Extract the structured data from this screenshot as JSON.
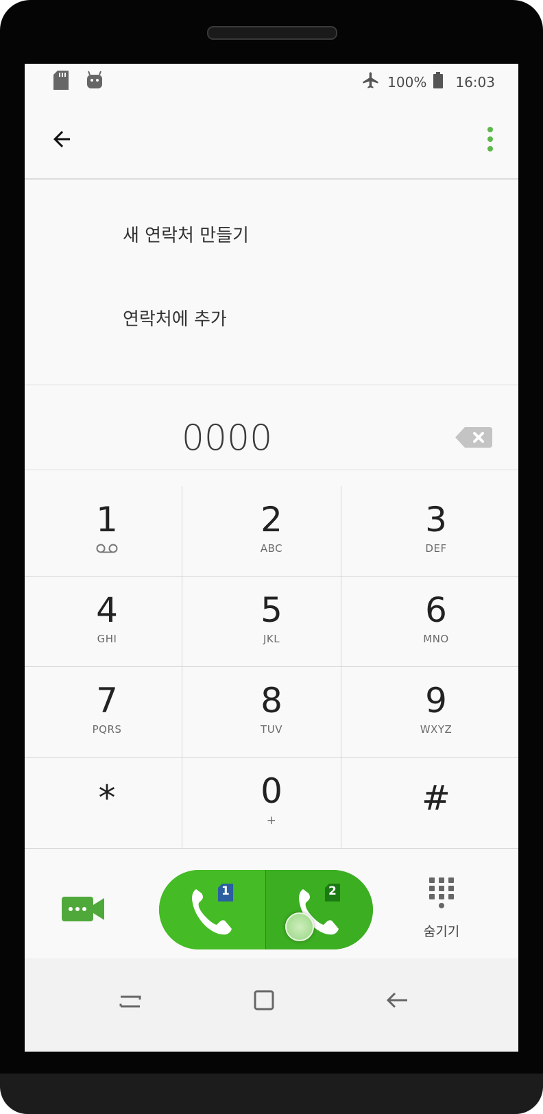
{
  "status_bar": {
    "battery": "100%",
    "time": "16:03",
    "left_icons": [
      "sd-card-icon",
      "android-icon"
    ],
    "right_icons": [
      "airplane-mode-icon",
      "battery-icon"
    ]
  },
  "app_bar": {
    "back_icon": "arrow-left-icon",
    "more_icon": "more-vertical-icon",
    "accent_color": "#5cb84a"
  },
  "menu": {
    "items": [
      {
        "label": "새 연락처 만들기"
      },
      {
        "label": "연락처에 추가"
      }
    ]
  },
  "dialer": {
    "number": "0000",
    "backspace_icon": "backspace-icon"
  },
  "keypad": {
    "keys": [
      {
        "digit": "1",
        "letters": "",
        "icon": "voicemail-icon"
      },
      {
        "digit": "2",
        "letters": "ABC"
      },
      {
        "digit": "3",
        "letters": "DEF"
      },
      {
        "digit": "4",
        "letters": "GHI"
      },
      {
        "digit": "5",
        "letters": "JKL"
      },
      {
        "digit": "6",
        "letters": "MNO"
      },
      {
        "digit": "7",
        "letters": "PQRS"
      },
      {
        "digit": "8",
        "letters": "TUV"
      },
      {
        "digit": "9",
        "letters": "WXYZ"
      },
      {
        "digit": "*",
        "letters": ""
      },
      {
        "digit": "0",
        "letters": "+"
      },
      {
        "digit": "#",
        "letters": ""
      }
    ]
  },
  "actions": {
    "video_call_icon": "video-call-icon",
    "sim1_label": "1",
    "sim2_label": "2",
    "call_color": "#44b82a",
    "hide_label": "숨기기",
    "hide_icon": "dialpad-icon"
  },
  "nav_bar": {
    "icons": [
      "recents-icon",
      "home-icon",
      "back-icon"
    ]
  }
}
